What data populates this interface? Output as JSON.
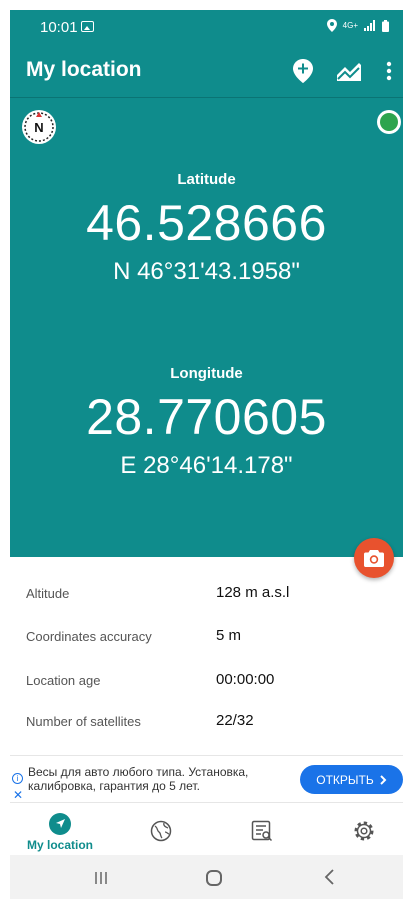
{
  "status_bar": {
    "time": "10:01",
    "network": "4G+"
  },
  "app_bar": {
    "title": "My location"
  },
  "coords": {
    "latitude": {
      "label": "Latitude",
      "decimal": "46.528666",
      "dms": "N 46°31'43.1958\""
    },
    "longitude": {
      "label": "Longitude",
      "decimal": "28.770605",
      "dms": "E 28°46'14.178\""
    }
  },
  "compass": {
    "letter": "N"
  },
  "info": [
    {
      "key": "Altitude",
      "value": "128 m a.s.l"
    },
    {
      "key": "Coordinates accuracy",
      "value": "5 m"
    },
    {
      "key": "Location age",
      "value": "00:00:00"
    },
    {
      "key": "Number of satellites",
      "value": "22/32"
    }
  ],
  "ad": {
    "text": "Весы для авто любого типа. Установка, калибровка, гарантия до 5 лет.",
    "cta": "ОТКРЫТЬ"
  },
  "bottom_nav": {
    "my_location_label": "My location"
  },
  "colors": {
    "primary": "#0f8c8c",
    "fab": "#e8522e",
    "gps_ok": "#2da44e",
    "ad_cta": "#1a73e8"
  }
}
